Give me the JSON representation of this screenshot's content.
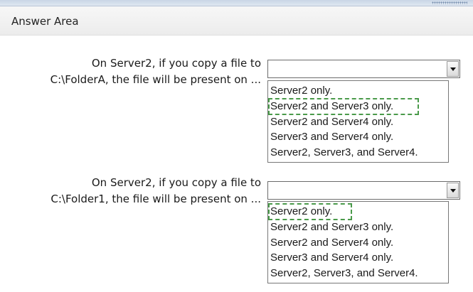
{
  "header": {
    "title": "Answer Area"
  },
  "questions": [
    {
      "prompt_line1": "On Server2, if you copy a file to",
      "prompt_line2": "C:\\FolderA, the file will be present on ...",
      "selected_value": "",
      "options": [
        "Server2 only.",
        "Server2 and Server3 only.",
        "Server2 and Server4 only.",
        "Server3 and Server4 only.",
        "Server2, Server3, and Server4."
      ],
      "selected_option_index": 1
    },
    {
      "prompt_line1": "On Server2, if you copy a file to",
      "prompt_line2": "C:\\Folder1, the file will be present on ...",
      "selected_value": "",
      "options": [
        "Server2 only.",
        "Server2 and Server3 only.",
        "Server2 and Server4 only.",
        "Server3 and Server4 only.",
        "Server2, Server3, and Server4."
      ],
      "selected_option_index": 0
    }
  ],
  "colors": {
    "selection_outline": "#4a9a4a",
    "header_bg": "#ececec"
  }
}
